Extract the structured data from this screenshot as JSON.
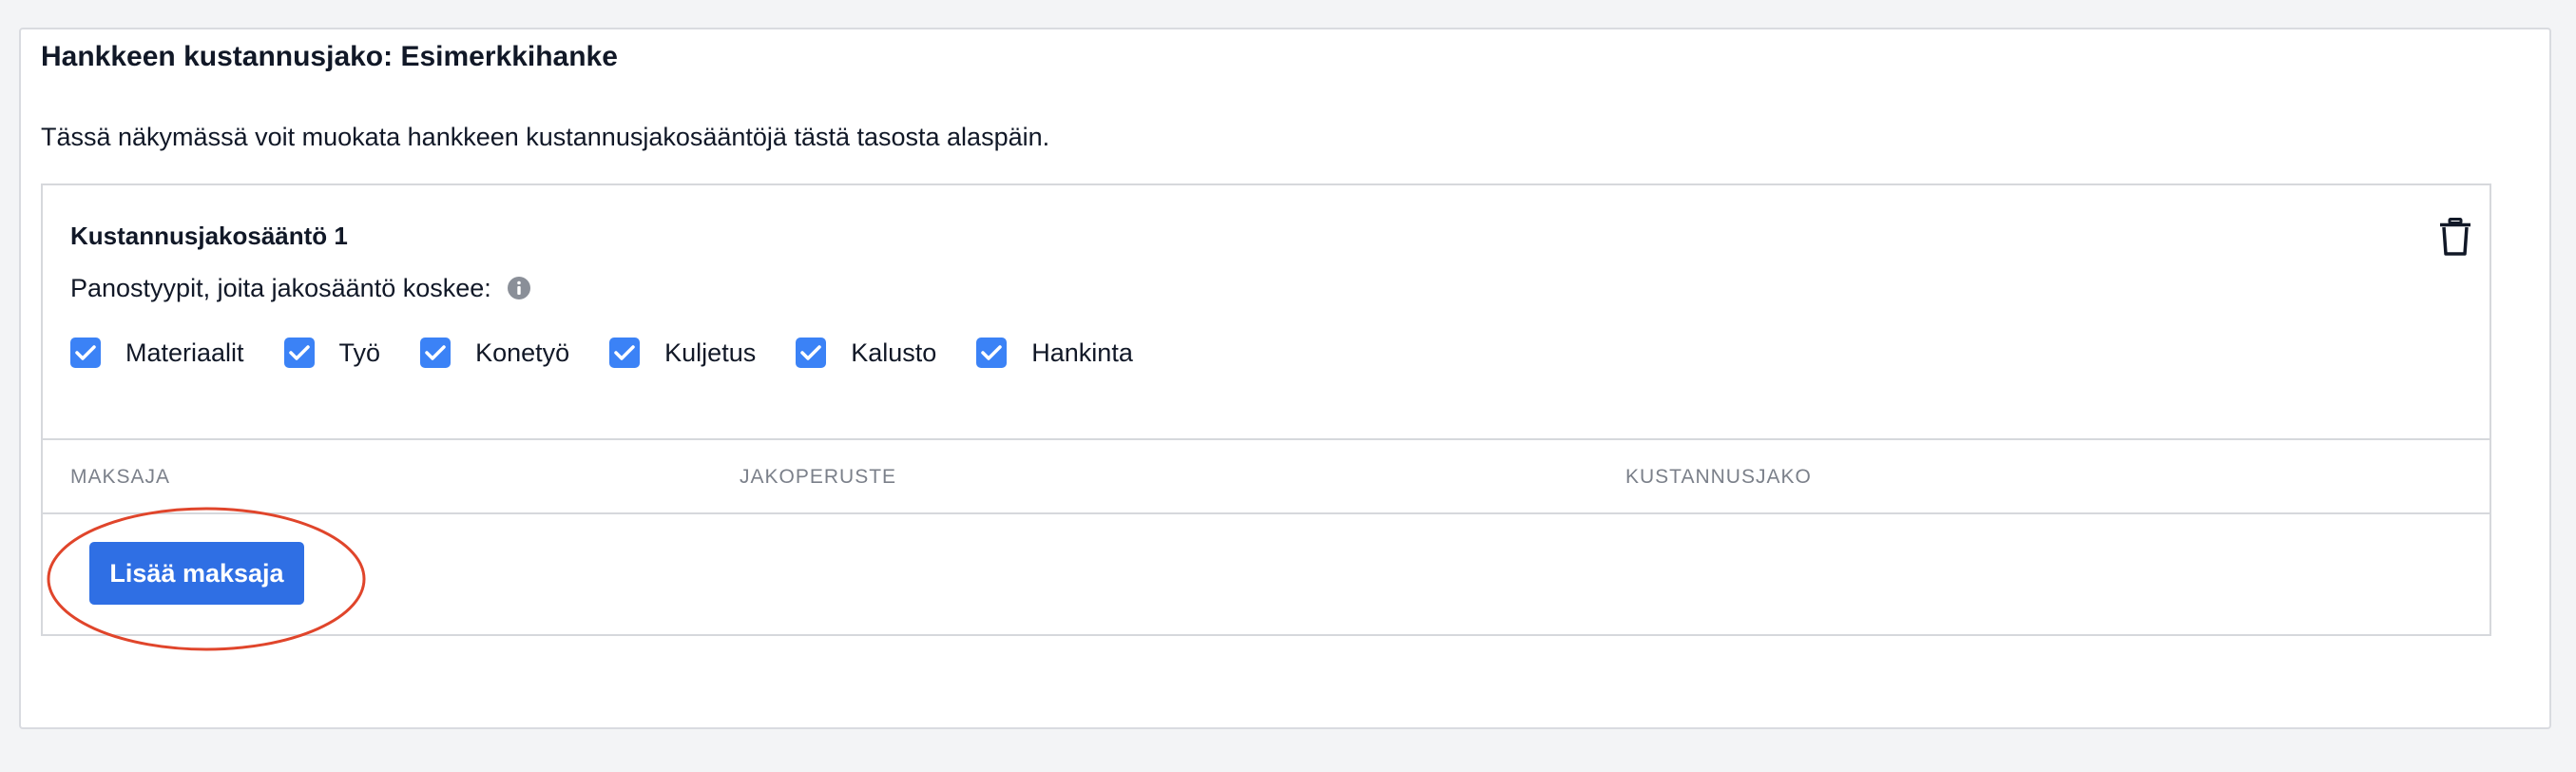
{
  "page": {
    "title": "Hankkeen kustannusjako: Esimerkkihanke",
    "intro": "Tässä näkymässä voit muokata hankkeen kustannusjakosääntöjä tästä tasosta alaspäin."
  },
  "rule": {
    "title": "Kustannusjakosääntö 1",
    "types_label": "Panostyypit, joita jakosääntö koskee:",
    "checkboxes": [
      {
        "label": "Materiaalit",
        "checked": true
      },
      {
        "label": "Työ",
        "checked": true
      },
      {
        "label": "Konetyö",
        "checked": true
      },
      {
        "label": "Kuljetus",
        "checked": true
      },
      {
        "label": "Kalusto",
        "checked": true
      },
      {
        "label": "Hankinta",
        "checked": true
      }
    ],
    "columns": [
      "MAKSAJA",
      "JAKOPERUSTE",
      "KUSTANNUSJAKO"
    ],
    "add_payer_label": "Lisää maksaja"
  },
  "icons": {
    "delete": "trash-icon",
    "info": "info-icon",
    "check": "checkmark-icon"
  },
  "colors": {
    "accent": "#2f6fe4",
    "checkbox": "#3b82f6",
    "highlight": "#e0452b",
    "muted_text": "#7b808a"
  }
}
